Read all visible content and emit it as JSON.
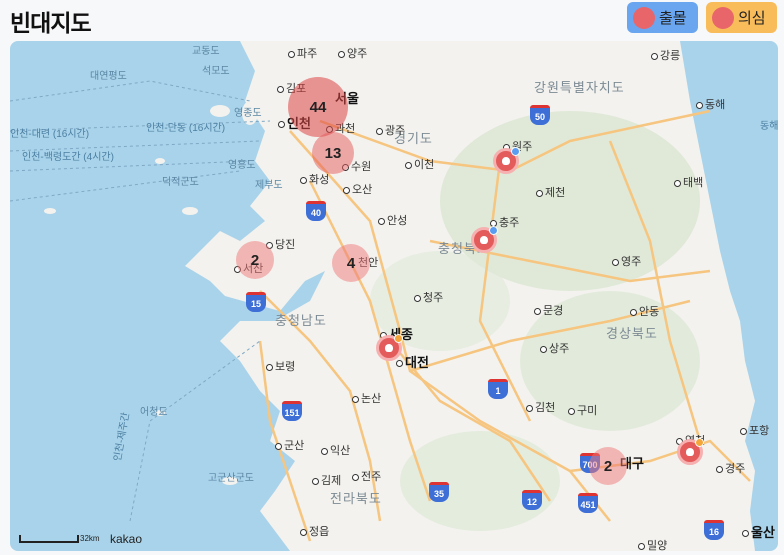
{
  "header": {
    "title": "빈대지도",
    "buttons": [
      {
        "label": "출몰",
        "color": "#6aa6ef",
        "icon": "bedbug-icon"
      },
      {
        "label": "의심",
        "color": "#f8bc5b",
        "icon": "bedbug-question-icon"
      }
    ]
  },
  "map": {
    "colors": {
      "sea": "#a9d3ea",
      "land": "#f3f2ee",
      "green": "#d7e6cf",
      "road": "#f6c57f",
      "cluster": "#e66a6a",
      "marker": "#e35b5b"
    },
    "clusters": [
      {
        "count": "44"
      },
      {
        "count": "13"
      },
      {
        "count": "2"
      },
      {
        "count": "4"
      },
      {
        "count": "2"
      }
    ],
    "labels": {
      "gyodong": "교동도",
      "seomodo": "석모도",
      "daeyeonpyeong": "대연평도",
      "yeongjong": "영종도",
      "gimpo": "김포",
      "paju": "파주",
      "yangju": "양주",
      "gangneung": "강릉",
      "gangwon": "강원특별자치도",
      "donghae": "동해",
      "seoul": "서울",
      "incheon": "인천",
      "gwacheon": "과천",
      "gwangju_g": "광주",
      "gyeonggi": "경기도",
      "incheon_dandong": "인천-단동 (16시간)",
      "incheon_dalian": "인천-대련 (16시간)",
      "incheon_baengnyeong": "인천-백령도간 (4시간)",
      "donghae_route": "동해",
      "suwon": "수원",
      "icheon": "이천",
      "wonju": "원주",
      "yeongheung": "영흥도",
      "deokjeok": "덕적군도",
      "jebu": "제부도",
      "hwaseong": "화성",
      "osan": "오산",
      "jecheon": "제천",
      "taebaek": "태백",
      "anseong": "안성",
      "chungju": "충주",
      "dangjin": "당진",
      "chungbuk": "충청북도",
      "cheonan": "천안",
      "seosan": "서산",
      "yeongju": "영주",
      "cheongju": "청주",
      "chungnam": "충청남도",
      "mungyeong": "문경",
      "andong": "안동",
      "sejong": "세종",
      "gyeongbuk": "경상북도",
      "sangju": "상주",
      "daejeon": "대전",
      "boryeong": "보령",
      "nonsan": "논산",
      "gimcheon": "김천",
      "gumi": "구미",
      "eocheong": "어청도",
      "incheon_jeju": "인천-제주간",
      "pohang": "포항",
      "gunsan": "군산",
      "iksan": "익산",
      "daegu": "대구",
      "yeongcheon": "영천",
      "gyeongju": "경주",
      "gogunsan": "고군산군도",
      "gimje": "김제",
      "jeonju": "전주",
      "jeonbuk": "전라북도",
      "jeongeup": "정읍",
      "miryang": "밀양",
      "ulsan": "울산"
    },
    "route_shields": [
      "50",
      "40",
      "15",
      "1",
      "151",
      "35",
      "12",
      "700",
      "451",
      "16"
    ],
    "scale_label": "32km",
    "attribution": "kakao"
  }
}
